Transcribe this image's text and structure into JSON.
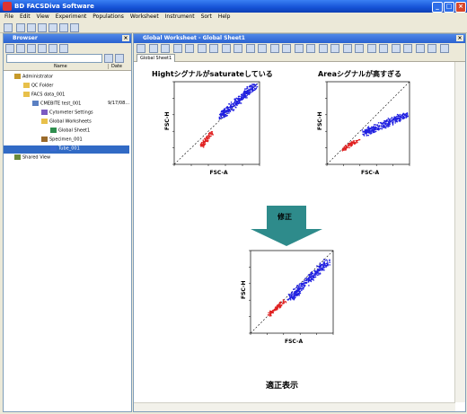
{
  "window": {
    "title": "BD FACSDiva Software"
  },
  "menu": [
    "File",
    "Edit",
    "View",
    "Experiment",
    "Populations",
    "Worksheet",
    "Instrument",
    "Sort",
    "Help"
  ],
  "browser": {
    "title": "Browser",
    "columns": {
      "name": "Name",
      "date": "Date"
    },
    "tree": [
      {
        "label": "Administrator",
        "indent": 0,
        "icon": "user-icon",
        "date": ""
      },
      {
        "label": "QC Folder",
        "indent": 1,
        "icon": "folder-icon",
        "date": ""
      },
      {
        "label": "FACS data_001",
        "indent": 1,
        "icon": "folder-icon",
        "date": ""
      },
      {
        "label": "CMEBITE test_001",
        "indent": 2,
        "icon": "experiment-icon",
        "date": "9/17/08..."
      },
      {
        "label": "Cytometer Settings",
        "indent": 3,
        "icon": "settings-icon",
        "date": ""
      },
      {
        "label": "Global Worksheets",
        "indent": 3,
        "icon": "folder-icon",
        "date": ""
      },
      {
        "label": "Global Sheet1",
        "indent": 4,
        "icon": "sheet-icon",
        "date": ""
      },
      {
        "label": "Specimen_001",
        "indent": 3,
        "icon": "specimen-icon",
        "date": ""
      },
      {
        "label": "Tube_001",
        "indent": 4,
        "icon": "tube-icon",
        "date": "",
        "selected": true
      },
      {
        "label": "Shared View",
        "indent": 0,
        "icon": "shared-icon",
        "date": ""
      }
    ]
  },
  "worksheet": {
    "title": "Global Worksheet - Global Sheet1",
    "tab": "Global Sheet1"
  },
  "annotations": {
    "plot1_title": "Hightシグナルがsaturateしている",
    "plot2_title": "Areaシグナルが高すぎる",
    "arrow_label": "修正",
    "plot3_caption": "適正表示"
  },
  "plots": {
    "xlabel": "FSC-A",
    "ylabel": "FSC-H"
  },
  "colors": {
    "red_population": "#e02020",
    "blue_population": "#2020e0",
    "arrow": "#2e8b8b"
  }
}
